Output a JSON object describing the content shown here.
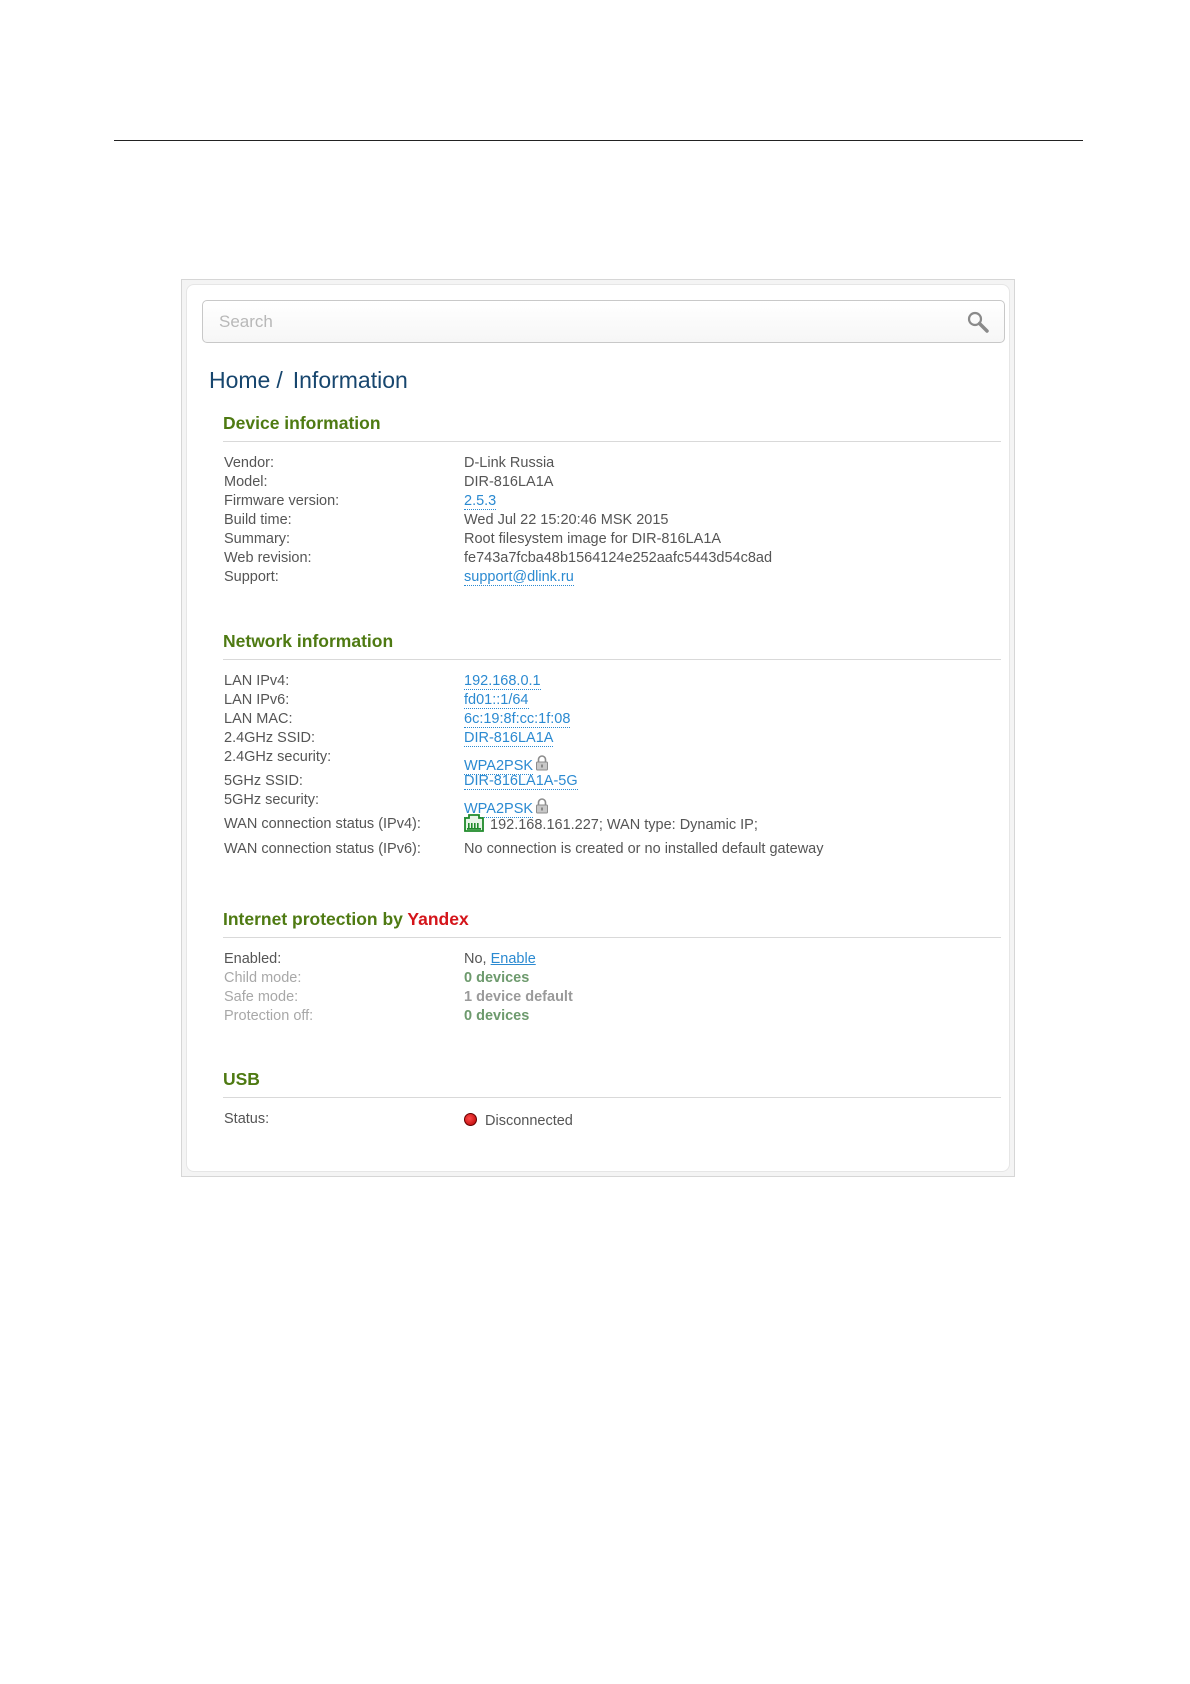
{
  "search": {
    "placeholder": "Search"
  },
  "breadcrumb": {
    "home": "Home",
    "separator": "/",
    "current": "Information"
  },
  "device": {
    "title": "Device information",
    "rows": [
      {
        "label": "Vendor:",
        "value": "D-Link Russia"
      },
      {
        "label": "Model:",
        "value": "DIR-816LA1A"
      },
      {
        "label": "Firmware version:",
        "value": "2.5.3"
      },
      {
        "label": "Build time:",
        "value": "Wed Jul 22 15:20:46 MSK 2015"
      },
      {
        "label": "Summary:",
        "value": "Root filesystem image for DIR-816LA1A"
      },
      {
        "label": "Web revision:",
        "value": "fe743a7fcba48b1564124e252aafc5443d54c8ad"
      },
      {
        "label": "Support:",
        "value": "support@dlink.ru"
      }
    ]
  },
  "network": {
    "title": "Network information",
    "rows": [
      {
        "label": "LAN IPv4:",
        "value": "192.168.0.1"
      },
      {
        "label": "LAN IPv6:",
        "value": "fd01::1/64"
      },
      {
        "label": "LAN MAC:",
        "value": "6c:19:8f:cc:1f:08"
      },
      {
        "label": "2.4GHz SSID:",
        "value": "DIR-816LA1A"
      },
      {
        "label": "2.4GHz security:",
        "value": "WPA2PSK"
      },
      {
        "label": "5GHz SSID:",
        "value": "DIR-816LA1A-5G"
      },
      {
        "label": "5GHz security:",
        "value": "WPA2PSK"
      },
      {
        "label": "WAN connection status (IPv4):",
        "value": "192.168.161.227; WAN type: Dynamic IP;"
      },
      {
        "label": "WAN connection status (IPv6):",
        "value": "No connection is created or no installed default gateway"
      }
    ]
  },
  "protection": {
    "title_prefix": "Internet protection by ",
    "title_brand": "Yandex",
    "rows": [
      {
        "label": "Enabled:",
        "value": "No,",
        "action": "Enable"
      },
      {
        "label": "Child mode:",
        "value": "0 devices"
      },
      {
        "label": "Safe mode:",
        "value": "1 device default"
      },
      {
        "label": "Protection off:",
        "value": "0 devices"
      }
    ]
  },
  "usb": {
    "title": "USB",
    "rows": [
      {
        "label": "Status:",
        "value": "Disconnected"
      }
    ]
  },
  "colors": {
    "section_title": "#4e7a12",
    "breadcrumb": "#17466e",
    "link": "#2b8ad1",
    "brand_accent": "#d4141a",
    "status_disconnected": "#d40000"
  }
}
